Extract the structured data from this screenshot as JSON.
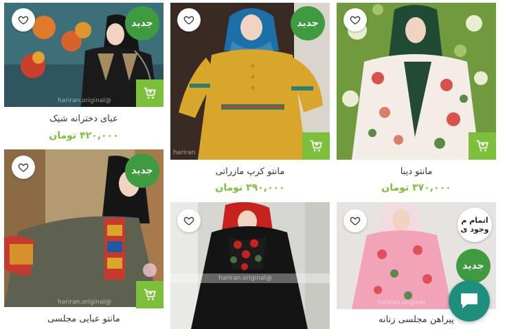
{
  "products": [
    {
      "name": "عبای دخترانه شیک",
      "price": "۴۲۰,۰۰۰ تومان",
      "badge": "جدید",
      "watermark": "@hariran.original"
    },
    {
      "name": "مانتو کرپ مازراتی",
      "price": "۳۹۰,۰۰۰ تومان",
      "badge": "جدید",
      "watermark": "hariran"
    },
    {
      "name": "مانتو دیبا",
      "price": "۳۷۰,۰۰۰ تومان",
      "badge": "",
      "watermark": ""
    },
    {
      "name": "مانتو عبایی مجلسی",
      "price": "",
      "badge": "جدید",
      "watermark": "@hariran.original"
    },
    {
      "name": "",
      "price": "",
      "badge": "",
      "watermark": "@hariran.original"
    },
    {
      "name": "پیراهن مجلسی زنانه",
      "price": "",
      "badge": "جدید",
      "out_of_stock": "اتمام م وجود ی",
      "watermark": "hariran.original"
    }
  ],
  "colors": {
    "badge_green": "#3f9b3f",
    "cart_green": "#7cbf3a",
    "price_green": "#7cbf3a",
    "chat_teal": "#1f8f7d"
  },
  "icons": {
    "wishlist": "heart-outline-icon",
    "cart": "add-to-cart-icon",
    "chat": "chat-bubble-icon"
  }
}
